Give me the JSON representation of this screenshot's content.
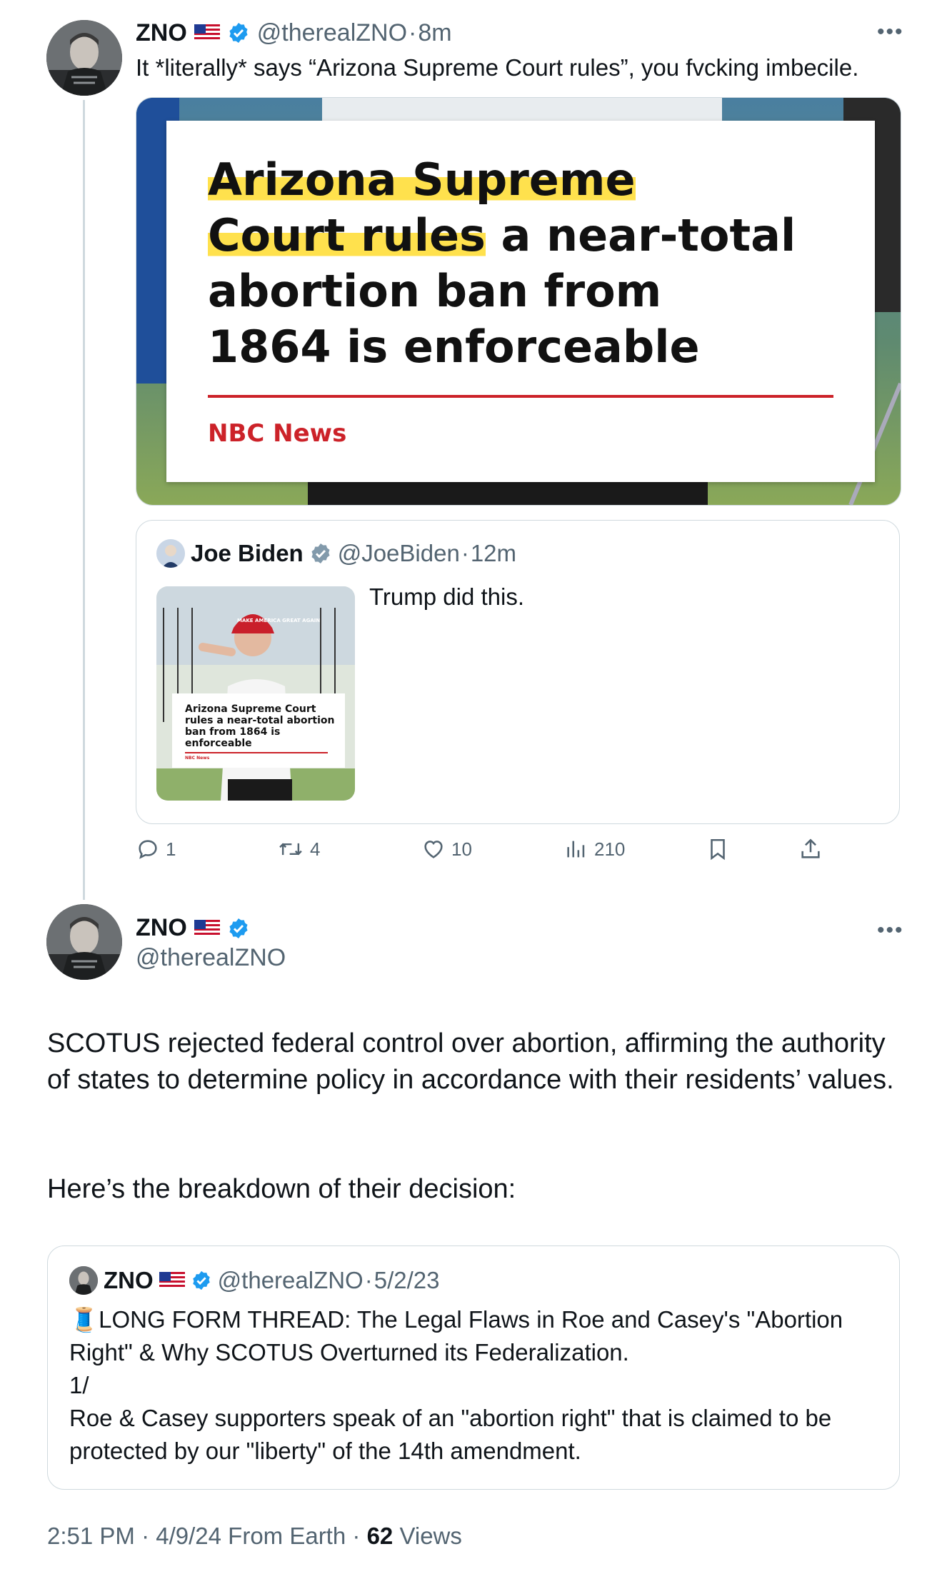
{
  "colors": {
    "accent": "#1d9bf0",
    "nbc_red": "#cc2229",
    "highlight": "#ffe14d"
  },
  "reply_tweet": {
    "author_name": "ZNO",
    "handle": "@therealZNO",
    "sep": "·",
    "time": "8m",
    "text": "It *literally* says “Arizona Supreme Court rules”, you fvcking imbecile.",
    "image": {
      "headline_line1": "Arizona Supreme",
      "headline_line2a": "Court rules",
      "headline_line2b": " a near-total",
      "headline_line3": "abortion ban from",
      "headline_line4": "1864 is enforceable",
      "source": "NBC News"
    },
    "quoted": {
      "author_name": "Joe Biden",
      "handle": "@JoeBiden",
      "sep": "·",
      "time": "12m",
      "text": "Trump did this.",
      "thumb_headline": "Arizona Supreme Court rules a near-total abortion ban from 1864 is enforceable",
      "thumb_source": "NBC News",
      "hat_text": "MAKE AMERICA GREAT AGAIN"
    },
    "actions": {
      "replies": "1",
      "retweets": "4",
      "likes": "10",
      "views": "210"
    }
  },
  "main_tweet": {
    "author_name": "ZNO",
    "handle": "@therealZNO",
    "text_p1": "SCOTUS rejected federal control over abortion, affirming the authority of states to determine policy in accordance with their residents’ values.",
    "text_p2": "Here’s the breakdown of their decision:",
    "quoted": {
      "author_name": "ZNO",
      "handle": "@therealZNO",
      "sep": "·",
      "date": "5/2/23",
      "line1": "🧵LONG FORM THREAD: The Legal Flaws in Roe and Casey's \"Abortion Right\" & Why SCOTUS Overturned its Federalization.",
      "line2": "1/",
      "line3": "Roe & Casey supporters speak of an \"abortion right\" that is claimed to be protected by our \"liberty\" of the 14th amendment."
    },
    "footer": {
      "time": "2:51 PM",
      "sep": "·",
      "date": "4/9/24",
      "source": "From Earth",
      "sep2": "·",
      "views_count": "62",
      "views_label": "Views"
    }
  }
}
